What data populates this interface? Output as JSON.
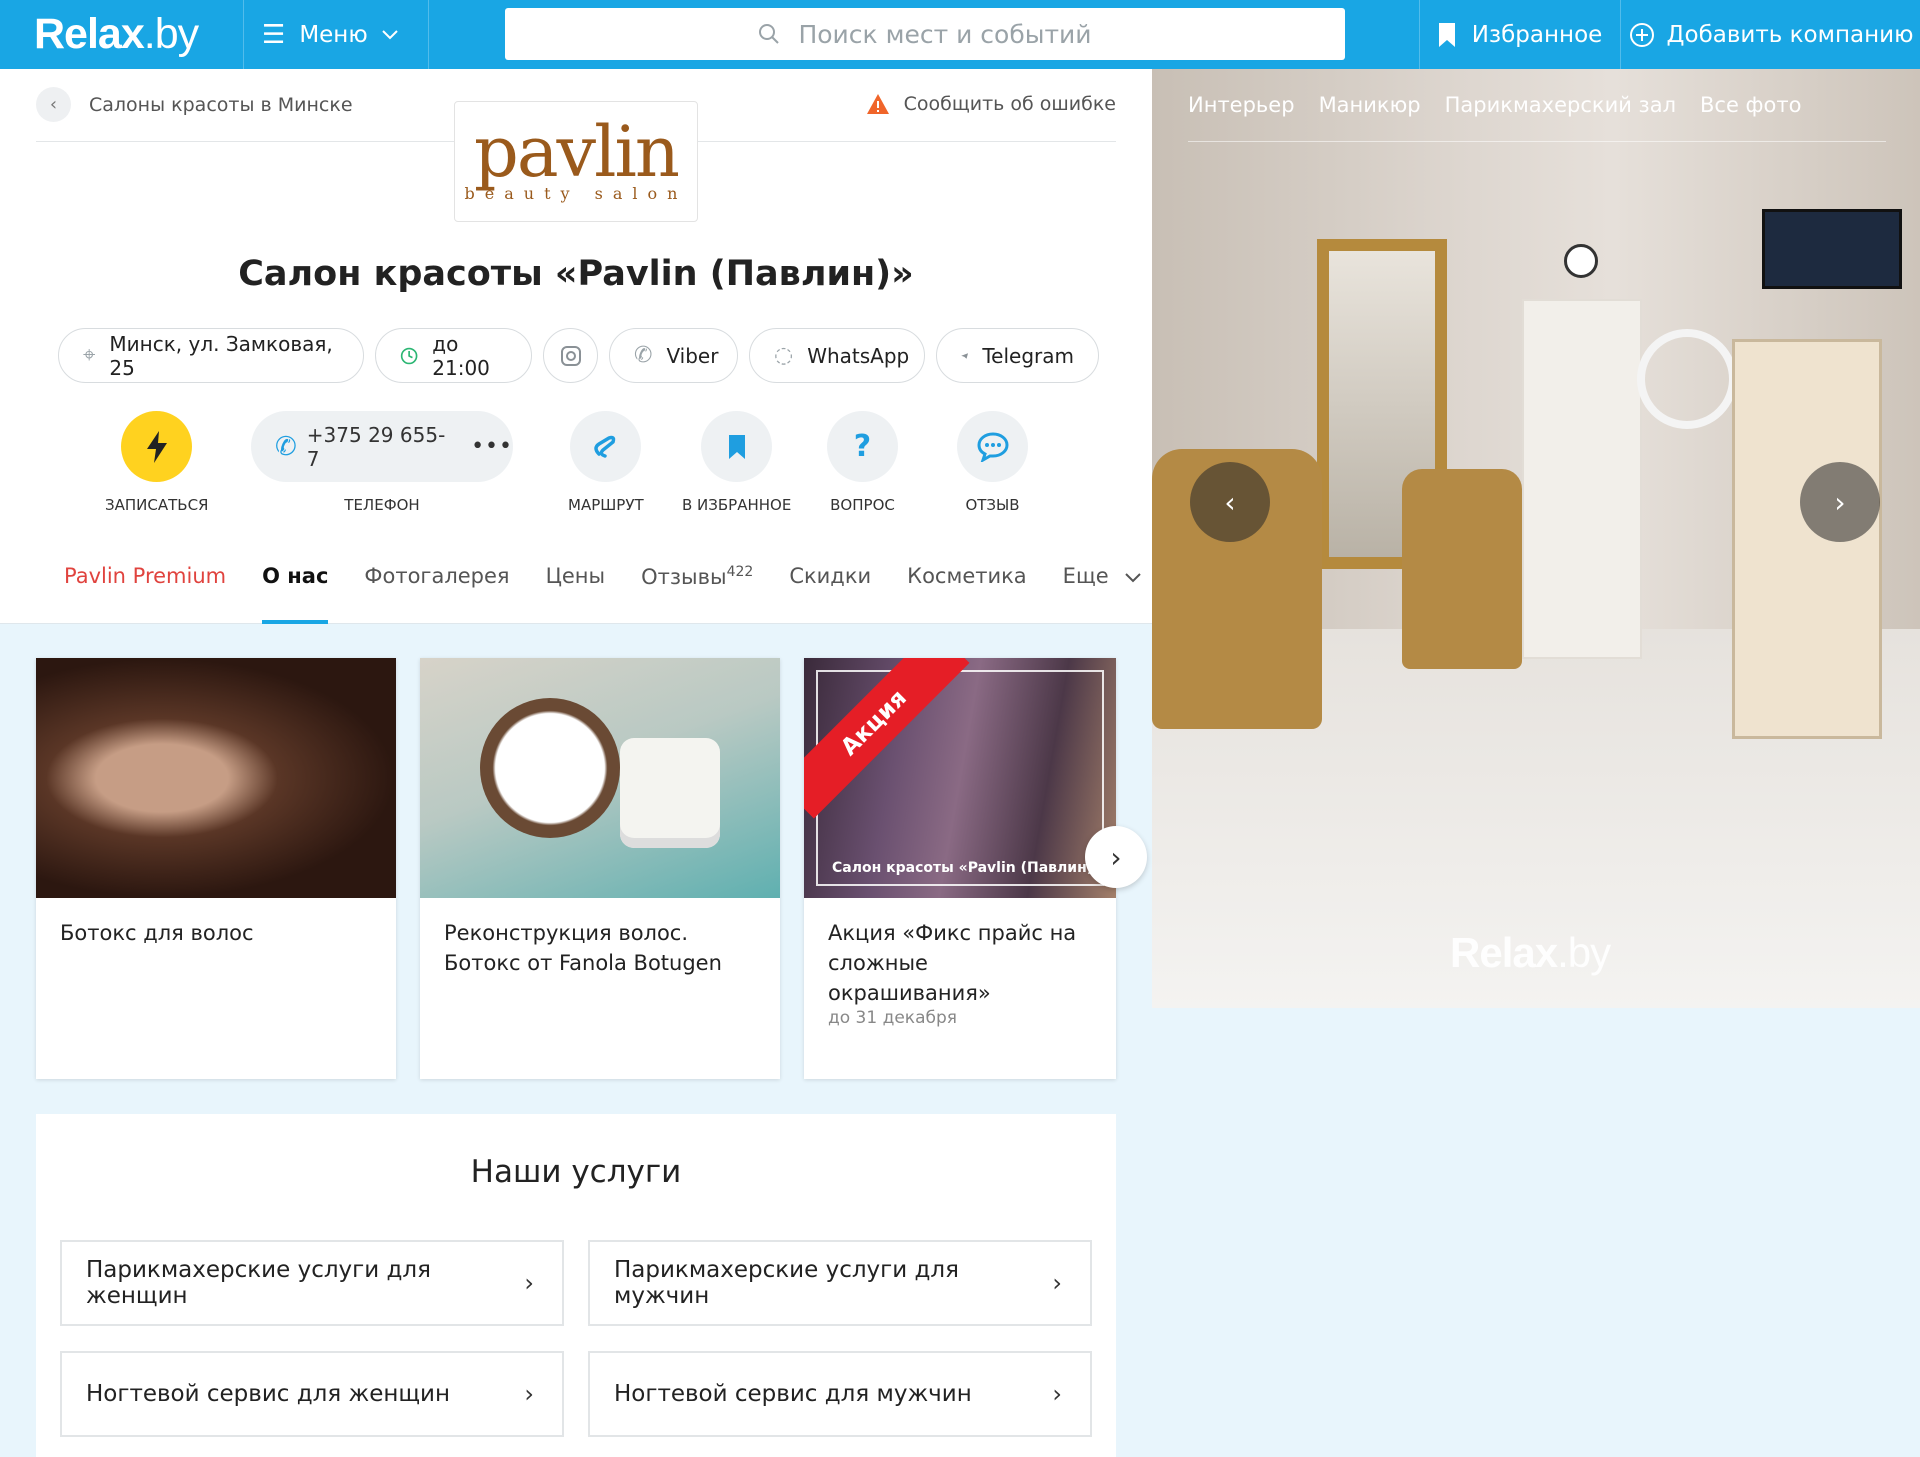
{
  "header": {
    "logo_bold": "Relax",
    "logo_light": ".by",
    "menu_label": "Меню",
    "search_placeholder": "Поиск мест и событий",
    "favorites_label": "Избранное",
    "add_company_label": "Добавить компанию"
  },
  "breadcrumb": {
    "label": "Салоны красоты в Минске",
    "report_label": "Сообщить об ошибке"
  },
  "brand_logo": {
    "main": "pavlin",
    "sub": "beauty salon"
  },
  "title": "Салон красоты «Pavlin (Павлин)»",
  "chips": {
    "address": "Минск, ул. Замковая, 25",
    "hours": "до 21:00",
    "viber": "Viber",
    "whatsapp": "WhatsApp",
    "telegram": "Telegram"
  },
  "actions": {
    "book": "ЗАПИСАТЬСЯ",
    "phone_number": "+375 29 655-7",
    "phone": "ТЕЛЕФОН",
    "route": "МАРШРУТ",
    "favorite": "В ИЗБРАННОЕ",
    "question": "ВОПРОС",
    "review": "ОТЗЫВ"
  },
  "tabs": {
    "premium": "Pavlin Premium",
    "about": "О нас",
    "gallery": "Фотогалерея",
    "prices": "Цены",
    "reviews": "Отзывы",
    "reviews_count": "422",
    "discounts": "Скидки",
    "cosmetics": "Косметика",
    "more": "Еще"
  },
  "cards": [
    {
      "title": "Ботокс для волос"
    },
    {
      "title": "Реконструкция волос. Ботокс от Fanola Botugen"
    },
    {
      "title": "Акция «Фикс прайс на сложные окрашивания»",
      "subtitle": "до 31 декабря",
      "badge": "Акция",
      "caption": "Салон красоты «Pavlin (Павлин)»"
    }
  ],
  "services": {
    "heading": "Наши услуги",
    "items": [
      "Парикмахерские услуги для женщин",
      "Парикмахерские услуги для мужчин",
      "Ногтевой сервис для женщин",
      "Ногтевой сервис для мужчин"
    ]
  },
  "photo_tabs": [
    "Интерьер",
    "Маникюр",
    "Парикмахерский зал",
    "Все фото"
  ],
  "photo_watermark": {
    "bold": "Relax",
    "light": ".by"
  },
  "colors": {
    "brand_blue": "#19a6e4",
    "premium_red": "#e0433e",
    "book_yellow": "#ffd21f"
  }
}
